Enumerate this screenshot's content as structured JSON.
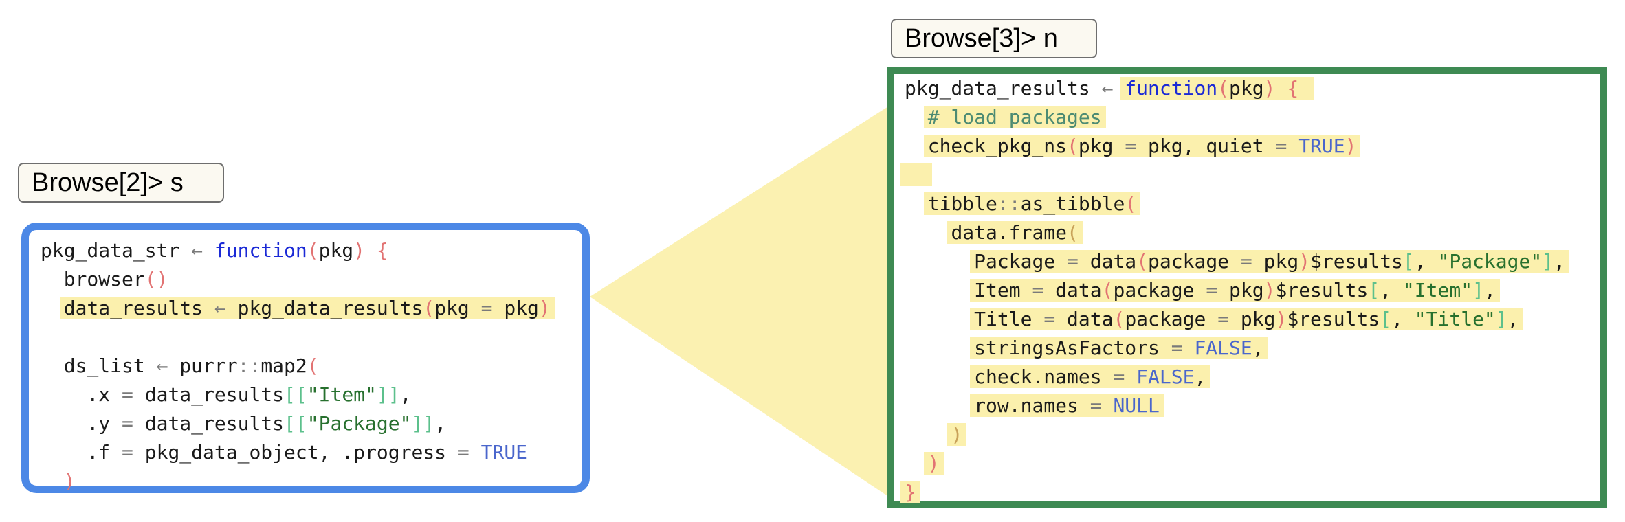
{
  "prompts": {
    "left": "Browse[2]> s",
    "right": "Browse[3]> n"
  },
  "colors": {
    "left_border": "#4c88e6",
    "right_border": "#3e8a53",
    "highlight": "#fbf0ad",
    "connector": "#fbf0ad"
  },
  "left_code": [
    "pkg_data_str ← function(pkg) {",
    "  browser()",
    "  data_results ← pkg_data_results(pkg = pkg)",
    "",
    "  ds_list ← purrr::map2(",
    "    .x = data_results[[\"Item\"]],",
    "    .y = data_results[[\"Package\"]],",
    "    .f = pkg_data_object, .progress = TRUE",
    "  )"
  ],
  "right_code": [
    "pkg_data_results ← function(pkg) {",
    "  # load packages",
    "  check_pkg_ns(pkg = pkg, quiet = TRUE)",
    "",
    "  tibble::as_tibble(",
    "    data.frame(",
    "      Package = data(package = pkg)$results[, \"Package\"],",
    "      Item = data(package = pkg)$results[, \"Item\"],",
    "      Title = data(package = pkg)$results[, \"Title\"],",
    "      stringsAsFactors = FALSE,",
    "      check.names = FALSE,",
    "      row.names = NULL",
    "    )",
    "  )",
    "}"
  ]
}
